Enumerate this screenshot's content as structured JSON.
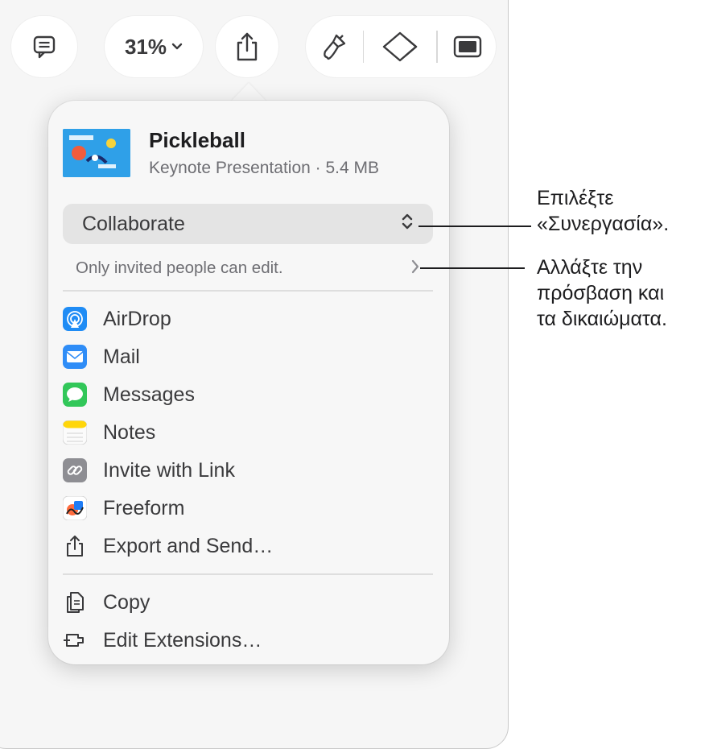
{
  "toolbar": {
    "zoom_label": "31%",
    "comment_icon": "comment-icon",
    "share_icon": "share-icon",
    "format_icon": "paintbrush-icon",
    "animate_icon": "diamond-icon",
    "document_icon": "sidebar-icon"
  },
  "share_popover": {
    "document": {
      "title": "Pickleball",
      "meta": "Keynote Presentation · 5.4 MB",
      "thumbnail_icon": "presentation-thumbnail"
    },
    "collaborate_select": {
      "value": "Collaborate",
      "icon": "up-down-chevron-icon"
    },
    "permissions_text": "Only invited people can edit.",
    "apps": [
      {
        "label": "AirDrop",
        "icon": "airdrop-icon",
        "color": "#1f8cf5"
      },
      {
        "label": "Mail",
        "icon": "mail-icon",
        "color": "#2f8df7"
      },
      {
        "label": "Messages",
        "icon": "messages-icon",
        "color": "#32c759"
      },
      {
        "label": "Notes",
        "icon": "notes-icon",
        "color": "#ffd60a"
      },
      {
        "label": "Invite with Link",
        "icon": "link-icon",
        "color": "#8e8e93"
      },
      {
        "label": "Freeform",
        "icon": "freeform-icon",
        "color": "#1e7cf5"
      },
      {
        "label": "Export and Send…",
        "icon": "export-icon",
        "color": "#3a3a3c"
      }
    ],
    "actions": [
      {
        "label": "Copy",
        "icon": "copy-icon"
      },
      {
        "label": "Edit Extensions…",
        "icon": "extensions-icon"
      }
    ]
  },
  "callouts": {
    "collaborate": [
      "Επιλέξτε",
      "«Συνεργασία»."
    ],
    "permissions": [
      "Αλλάξτε την",
      "πρόσβαση και",
      "τα δικαιώματα."
    ]
  }
}
